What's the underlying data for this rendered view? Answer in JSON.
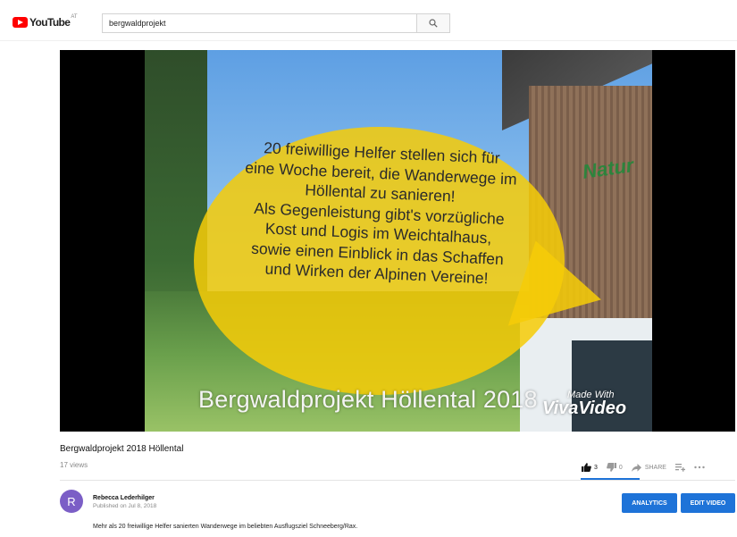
{
  "header": {
    "logo_text": "YouTube",
    "region_code": "AT",
    "search_value": "bergwaldprojekt"
  },
  "video": {
    "overlay_text": "20 freiwillige Helfer stellen sich für\neine Woche bereit, die Wanderwege im\nHöllental zu sanieren!\nAls Gegenleistung gibt's vorzügliche\nKost und Logis im Weichtalhaus,\nsowie einen Einblick in das Schaffen\nund Wirken der Alpinen Vereine!",
    "title_overlay": "Bergwaldprojekt Höllental 2018",
    "watermark_top": "Made With",
    "watermark_bottom": "VivaVideo",
    "sign_text": "Natur"
  },
  "info": {
    "title": "Bergwaldprojekt 2018 Höllental",
    "views": "17 views",
    "likes": "3",
    "dislikes": "0",
    "share_label": "SHARE"
  },
  "owner": {
    "avatar_letter": "R",
    "channel_name": "Rebecca Lederhilger",
    "published": "Published on Jul 8, 2018",
    "analytics_label": "ANALYTICS",
    "edit_label": "EDIT VIDEO"
  },
  "description": {
    "line1": "Mehr als 20 freiwillige Helfer sanierten Wanderwege im beliebten Ausflugsziel Schneeberg/Rax."
  },
  "colors": {
    "brand_red": "#ff0000",
    "accent_blue": "#1e73d8",
    "bubble_yellow": "#f6cc08",
    "avatar_purple": "#7b5ec6"
  },
  "icons": [
    "youtube-logo-icon",
    "search-icon",
    "thumbs-up-icon",
    "thumbs-down-icon",
    "share-icon",
    "add-to-playlist-icon",
    "more-icon"
  ]
}
